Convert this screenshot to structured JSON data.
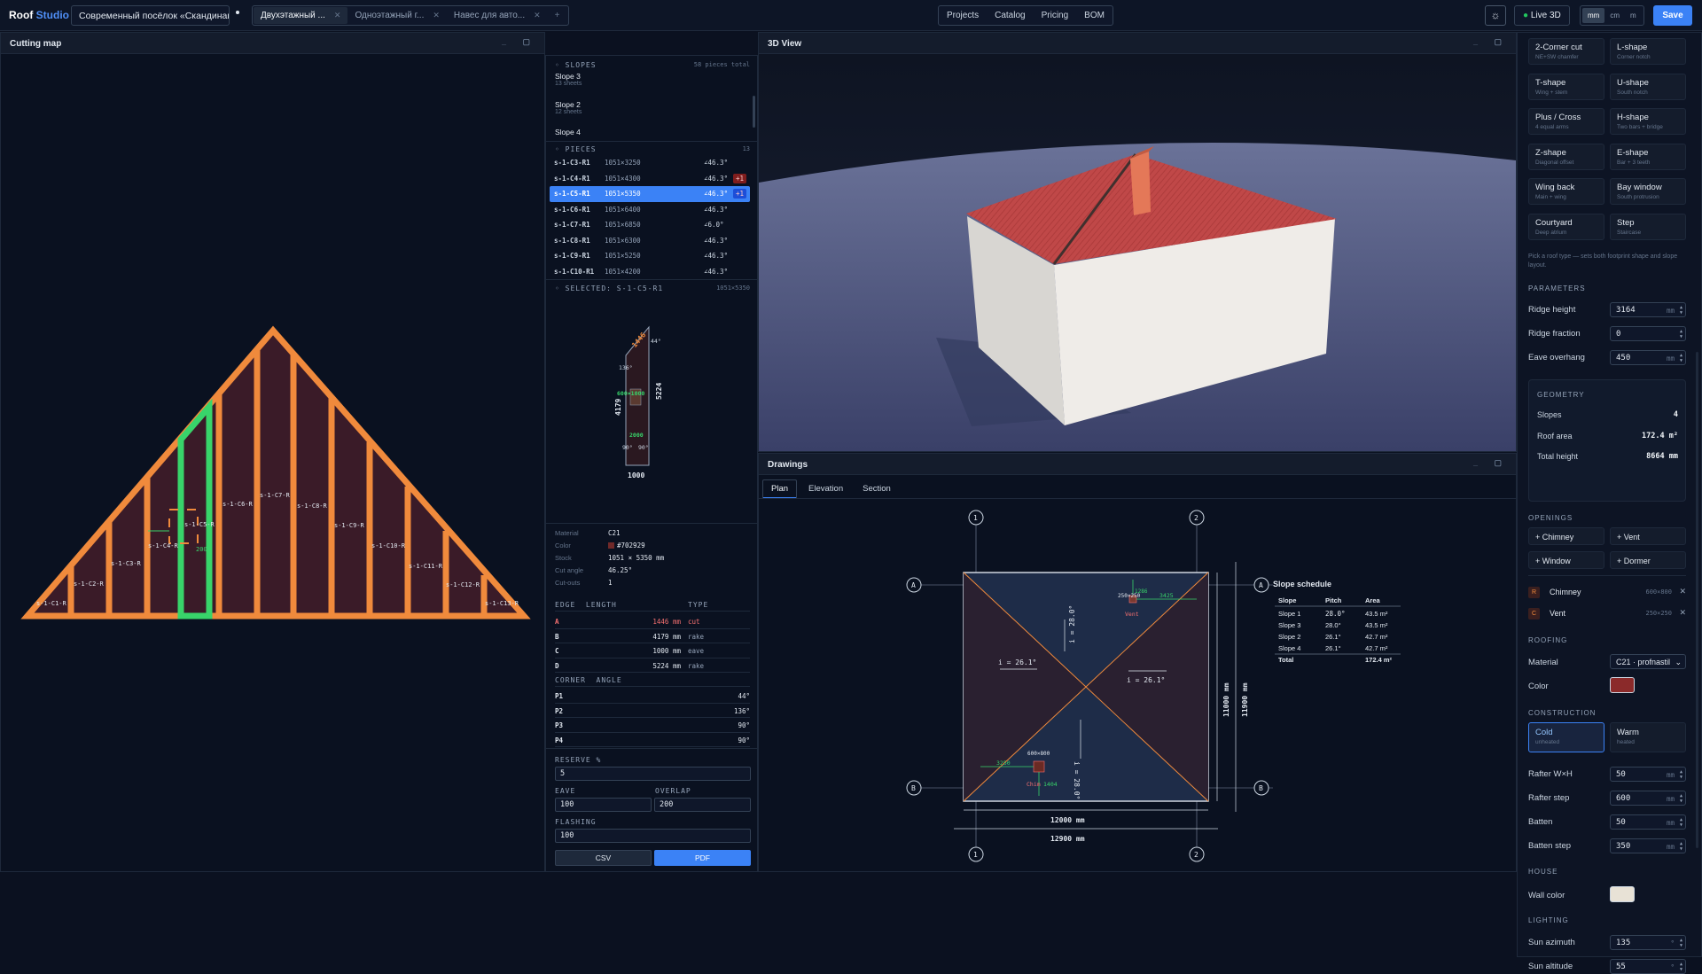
{
  "app": {
    "logo_a": "Roof",
    "logo_b": "Studio",
    "project": "Современный посёлок «Скандинавия»",
    "save": "Save",
    "live": "Live 3D",
    "sun_icon": "sun-icon"
  },
  "tabs": [
    {
      "label": "Двухэтажный ...",
      "active": true
    },
    {
      "label": "Одноэтажный г...",
      "active": false
    },
    {
      "label": "Навес для авто...",
      "active": false
    }
  ],
  "nav": [
    "Projects",
    "Catalog",
    "Pricing",
    "BOM"
  ],
  "units": [
    "mm",
    "cm",
    "m"
  ],
  "cutting": {
    "title": "Cutting map",
    "labels": [
      "s-1-C1-R",
      "s-1-C2-R",
      "s-1-C3-R",
      "s-1-C4-R",
      "s-1-C5-R",
      "s-1-C6-R",
      "s-1-C7-R",
      "s-1-C8-R",
      "s-1-C9-R",
      "s-1-C10-R",
      "s-1-C11-R",
      "s-1-C12-R",
      "s-1-C13-R"
    ],
    "dim": "2000"
  },
  "slopes": {
    "header": "SLOPES",
    "total": "58 pieces total",
    "items": [
      {
        "name": "Slope 3",
        "sheets": "13 sheets"
      },
      {
        "name": "Slope 2",
        "sheets": "12 sheets"
      },
      {
        "name": "Slope 4",
        "sheets": ""
      }
    ]
  },
  "pieces": {
    "header": "PIECES",
    "count": "13",
    "items": [
      {
        "id": "s-1-C3-R1",
        "size": "1051×3250",
        "angle": "∠46.3°",
        "badge": "",
        "sel": false
      },
      {
        "id": "s-1-C4-R1",
        "size": "1051×4300",
        "angle": "∠46.3°",
        "badge": "+1",
        "sel": false
      },
      {
        "id": "s-1-C5-R1",
        "size": "1051×5350",
        "angle": "∠46.3°",
        "badge": "+1",
        "sel": true
      },
      {
        "id": "s-1-C6-R1",
        "size": "1051×6400",
        "angle": "∠46.3°",
        "badge": "",
        "sel": false
      },
      {
        "id": "s-1-C7-R1",
        "size": "1051×6850",
        "angle": "∠6.0°",
        "badge": "",
        "sel": false
      },
      {
        "id": "s-1-C8-R1",
        "size": "1051×6300",
        "angle": "∠46.3°",
        "badge": "",
        "sel": false
      },
      {
        "id": "s-1-C9-R1",
        "size": "1051×5250",
        "angle": "∠46.3°",
        "badge": "",
        "sel": false
      },
      {
        "id": "s-1-C10-R1",
        "size": "1051×4200",
        "angle": "∠46.3°",
        "badge": "",
        "sel": false
      }
    ]
  },
  "selected": {
    "header": "SELECTED: S-1-C5-R1",
    "size": "1051×5350",
    "drawing": {
      "top": "1446",
      "angle_top": "44°",
      "angle_mid": "136°",
      "left": "4179",
      "right": "5224",
      "cut": "600×1000",
      "cut2": "2000",
      "a1": "90°",
      "a2": "90°",
      "bottom": "1000"
    },
    "props": [
      {
        "k": "Material",
        "v": "C21"
      },
      {
        "k": "Color",
        "v": "#702929"
      },
      {
        "k": "Stock",
        "v": "1051 × 5350 mm"
      },
      {
        "k": "Cut angle",
        "v": "46.25°"
      },
      {
        "k": "Cut-outs",
        "v": "1"
      }
    ],
    "edge_head": [
      "EDGE",
      "LENGTH",
      "TYPE"
    ],
    "edges": [
      {
        "e": "A",
        "l": "1446 mm",
        "t": "cut",
        "cut": true
      },
      {
        "e": "B",
        "l": "4179 mm",
        "t": "rake",
        "cut": false
      },
      {
        "e": "C",
        "l": "1000 mm",
        "t": "eave",
        "cut": false
      },
      {
        "e": "D",
        "l": "5224 mm",
        "t": "rake",
        "cut": false
      }
    ],
    "corner_head": [
      "CORNER",
      "ANGLE"
    ],
    "corners": [
      {
        "c": "P1",
        "a": "44°"
      },
      {
        "c": "P2",
        "a": "136°"
      },
      {
        "c": "P3",
        "a": "90°"
      },
      {
        "c": "P4",
        "a": "90°"
      }
    ],
    "reserve_label": "RESERVE %",
    "reserve": "5",
    "eave_label": "EAVE",
    "eave": "100",
    "overlap_label": "OVERLAP",
    "overlap": "200",
    "flashing_label": "FLASHING",
    "flashing": "100",
    "csv": "CSV",
    "pdf": "PDF"
  },
  "view3d": {
    "title": "3D View",
    "roof_color": "#b94a4a"
  },
  "drawings": {
    "title": "Drawings",
    "tabs": [
      "Plan",
      "Elevation",
      "Section"
    ],
    "axes_num": [
      "1",
      "2",
      "1",
      "2"
    ],
    "axes_let": [
      "A",
      "A",
      "B",
      "B"
    ],
    "dims": {
      "w1": "12000 mm",
      "w2": "12900 mm",
      "h1": "11000 mm",
      "h2": "11900 mm",
      "d1": "3425",
      "d2": "250×250",
      "d3": "1286",
      "d4": "3250",
      "d5": "600×800",
      "d6": "1404"
    },
    "slopes": {
      "s1": "i = 28.0°",
      "s2": "i = 26.1°",
      "s3": "i = 26.1°",
      "s4": "i = 28.0°"
    },
    "vent": "Vent",
    "chim": "Chim",
    "schedule": {
      "title": "Slope schedule",
      "cols": [
        "Slope",
        "Pitch",
        "Area"
      ],
      "rows": [
        [
          "Slope 1",
          "28.0°",
          "43.5 m²"
        ],
        [
          "Slope 3",
          "28.0°",
          "43.5 m²"
        ],
        [
          "Slope 2",
          "26.1°",
          "42.7 m²"
        ],
        [
          "Slope 4",
          "26.1°",
          "42.7 m²"
        ]
      ],
      "total": [
        "Total",
        "",
        "172.4 m²"
      ]
    }
  },
  "right": {
    "types": [
      {
        "t": "2-Corner cut",
        "s": "NE+SW chamfer"
      },
      {
        "t": "L-shape",
        "s": "Corner notch"
      },
      {
        "t": "T-shape",
        "s": "Wing + stem"
      },
      {
        "t": "U-shape",
        "s": "South notch"
      },
      {
        "t": "Plus / Cross",
        "s": "4 equal arms"
      },
      {
        "t": "H-shape",
        "s": "Two bars + bridge"
      },
      {
        "t": "Z-shape",
        "s": "Diagonal offset"
      },
      {
        "t": "E-shape",
        "s": "Bar + 3 teeth"
      },
      {
        "t": "Wing back",
        "s": "Main + wing"
      },
      {
        "t": "Bay window",
        "s": "South protrusion"
      },
      {
        "t": "Courtyard",
        "s": "Deep atrium"
      },
      {
        "t": "Step",
        "s": "Staircase"
      }
    ],
    "hint": "Pick a roof type — sets both footprint shape and slope layout.",
    "params_h": "PARAMETERS",
    "params": [
      {
        "l": "Ridge height",
        "v": "3164",
        "u": "mm"
      },
      {
        "l": "Ridge fraction",
        "v": "0",
        "u": ""
      },
      {
        "l": "Eave overhang",
        "v": "450",
        "u": "mm"
      }
    ],
    "geom_h": "GEOMETRY",
    "geom": [
      {
        "l": "Slopes",
        "v": "4"
      },
      {
        "l": "Roof area",
        "v": "172.4 m²"
      },
      {
        "l": "Total height",
        "v": "8664 mm"
      }
    ],
    "open_h": "OPENINGS",
    "open_btns": [
      "+ Chimney",
      "+ Vent",
      "+ Window",
      "+ Dormer"
    ],
    "openings": [
      {
        "i": "R",
        "n": "Chimney",
        "s": "600×800"
      },
      {
        "i": "C",
        "n": "Vent",
        "s": "250×250"
      }
    ],
    "roof_h": "ROOFING",
    "material_l": "Material",
    "material": "C21 · profnastil",
    "color_l": "Color",
    "roof_color": "#8b2a2a",
    "cons_h": "CONSTRUCTION",
    "cold": "Cold",
    "cold_s": "unheated",
    "warm": "Warm",
    "warm_s": "heated",
    "cons": [
      {
        "l": "Rafter W×H",
        "v": "50",
        "u": "mm"
      },
      {
        "l": "Rafter step",
        "v": "600",
        "u": "mm"
      },
      {
        "l": "Batten",
        "v": "50",
        "u": "mm"
      },
      {
        "l": "Batten step",
        "v": "350",
        "u": "mm"
      }
    ],
    "house_h": "HOUSE",
    "wall_l": "Wall color",
    "wall_color": "#e8e2d6",
    "light_h": "LIGHTING",
    "light": [
      {
        "l": "Sun azimuth",
        "v": "135",
        "u": "°"
      },
      {
        "l": "Sun altitude",
        "v": "55",
        "u": "°"
      }
    ]
  }
}
